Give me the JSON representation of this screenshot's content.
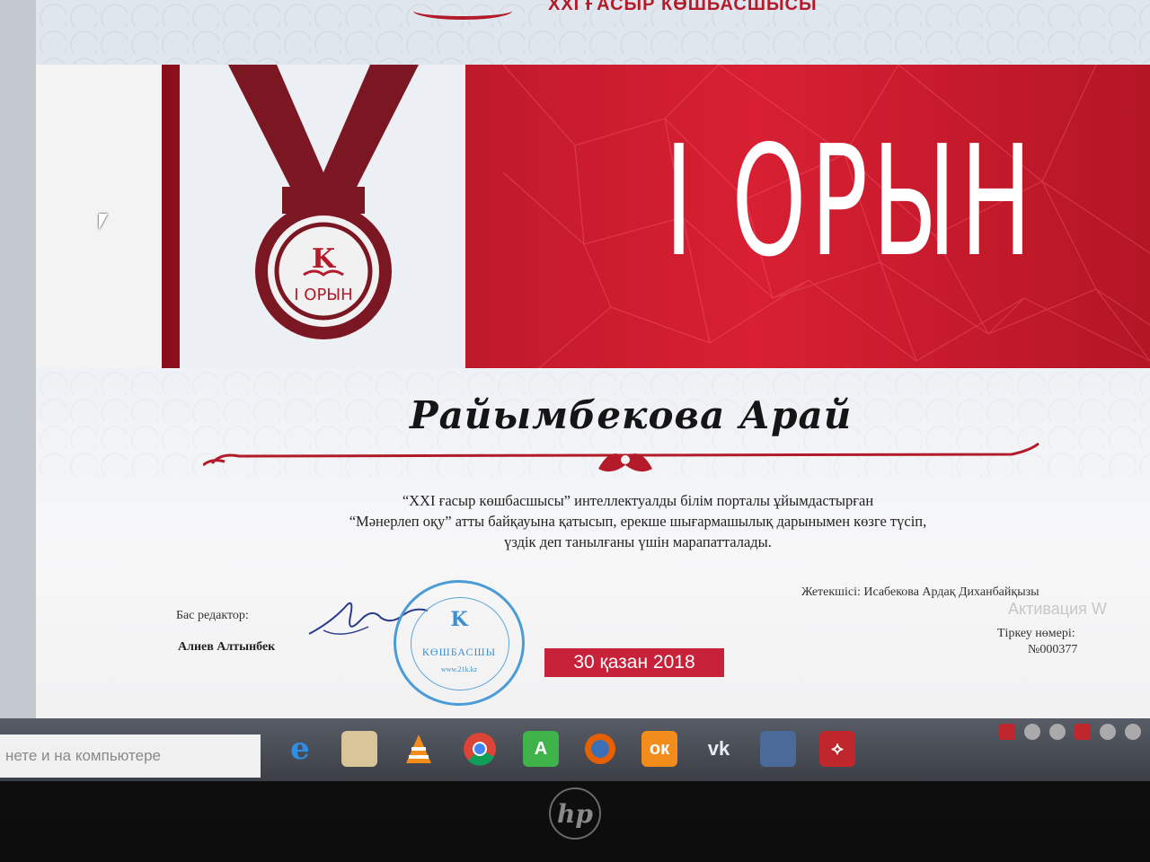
{
  "header": {
    "portal_title": "XXI ҒАСЫР КӨШБАСШЫСЫ"
  },
  "banner": {
    "place_text": "I ОРЫН",
    "medal_letter": "K",
    "medal_label": "I ОРЫН"
  },
  "certificate": {
    "recipient": "Райымбекова Арай",
    "body_lines": [
      "“XXI ғасыр көшбасшысы” интеллектуалды білім порталы ұйымдастырған",
      "“Мәнерлеп оқу” атты байқауына қатысып, ерекше шығармашылық дарынымен көзге түсіп,",
      "үздік деп танылғаны үшін марапатталады."
    ],
    "editor_label": "Бас редактор:",
    "editor_name": "Алиев Алтынбек",
    "date": "30 қазан 2018",
    "leader": "Жетекшісі: Исабекова Ардақ Диханбайқызы",
    "reg_label": "Тіркеу нөмері:",
    "reg_number": "№000377",
    "watermark": "Активация W"
  },
  "stamp": {
    "letter": "K",
    "word": "КӨШБАСШЫ",
    "url": "www.21k.kz"
  },
  "taskbar": {
    "search_text": "нете и на компьютере",
    "icons": [
      "internet-explorer-icon",
      "file-manager-icon",
      "vlc-icon",
      "chrome-icon",
      "a-app-icon",
      "firefox-icon",
      "odnoklassniki-icon",
      "vk-icon",
      "media-icon",
      "acrobat-icon"
    ]
  },
  "colors": {
    "accent_red": "#c8223a",
    "banner_red": "#c31b2c",
    "stamp_blue": "#3d8fd0",
    "medal_dark": "#7b1722"
  }
}
